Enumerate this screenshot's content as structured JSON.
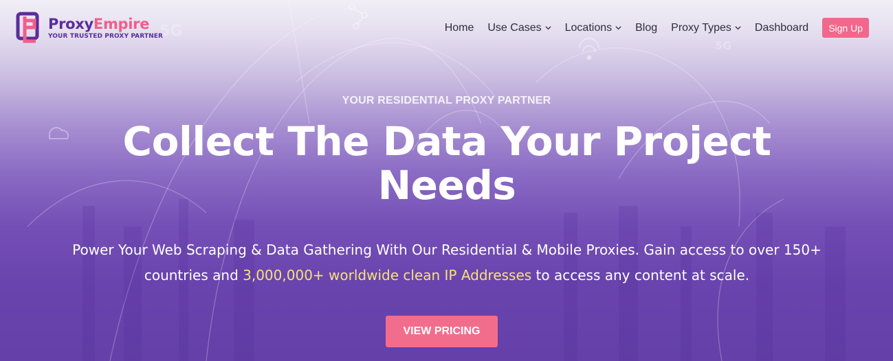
{
  "brand": {
    "name_part1": "Proxy",
    "name_part2": "Empire",
    "tagline": "YOUR TRUSTED PROXY PARTNER"
  },
  "nav": {
    "items": [
      {
        "label": "Home",
        "dropdown": false
      },
      {
        "label": "Use Cases",
        "dropdown": true
      },
      {
        "label": "Locations",
        "dropdown": true
      },
      {
        "label": "Blog",
        "dropdown": false
      },
      {
        "label": "Proxy Types",
        "dropdown": true
      },
      {
        "label": "Dashboard",
        "dropdown": false
      }
    ],
    "signup_label": "Sign Up"
  },
  "hero": {
    "eyebrow": "YOUR RESIDENTIAL PROXY PARTNER",
    "title": "Collect The Data Your Project Needs",
    "subtitle_before": "Power Your Web Scraping & Data Gathering  With Our Residential & Mobile Proxies. Gain access to over 150+ countries and ",
    "subtitle_highlight": "3,000,000+ worldwide clean IP Addresses",
    "subtitle_after": " to access any content at scale.",
    "cta_label": "VIEW PRICING"
  },
  "colors": {
    "accent_pink": "#f26d8c",
    "brand_purple": "#5a2d9a",
    "highlight_yellow": "#f7e27a"
  }
}
